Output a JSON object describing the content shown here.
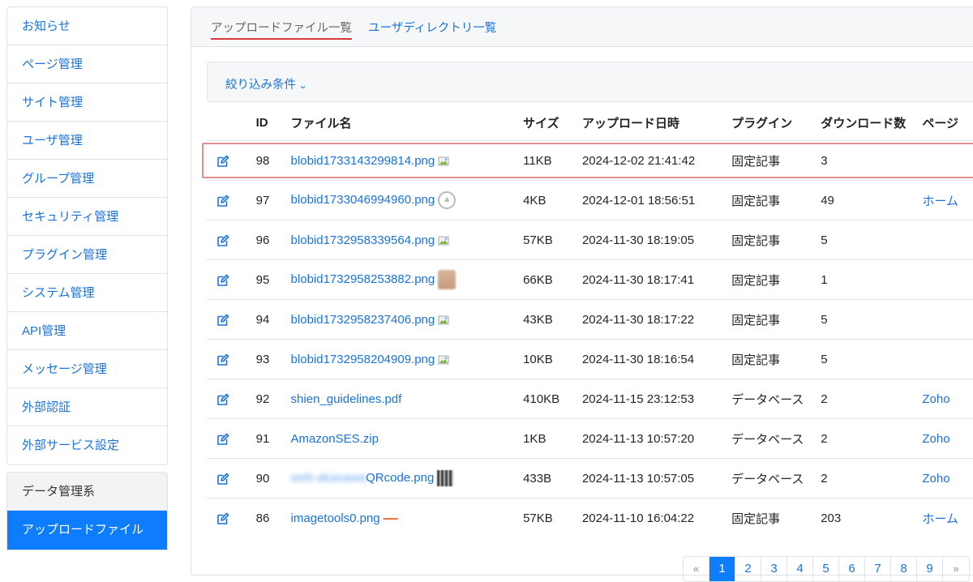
{
  "sidebar": {
    "items": [
      {
        "label": "お知らせ"
      },
      {
        "label": "ページ管理"
      },
      {
        "label": "サイト管理"
      },
      {
        "label": "ユーザ管理"
      },
      {
        "label": "グループ管理"
      },
      {
        "label": "セキュリティ管理"
      },
      {
        "label": "プラグイン管理"
      },
      {
        "label": "システム管理"
      },
      {
        "label": "API管理"
      },
      {
        "label": "メッセージ管理"
      },
      {
        "label": "外部認証"
      },
      {
        "label": "外部サービス設定"
      }
    ],
    "data_group_header": "データ管理系",
    "active_item": "アップロードファイル"
  },
  "tabs": {
    "uploaded_files": "アップロードファイル一覧",
    "user_directories": "ユーザディレクトリ一覧"
  },
  "filter": {
    "label": "絞り込み条件"
  },
  "table": {
    "headers": {
      "id": "ID",
      "name": "ファイル名",
      "size": "サイズ",
      "date": "アップロード日時",
      "plugin": "プラグイン",
      "downloads": "ダウンロード数",
      "page": "ページ"
    },
    "rows": [
      {
        "id": "98",
        "name": "blobid1733143299814.png",
        "thumb": "broken-image-icon",
        "size": "11KB",
        "date": "2024-12-02 21:41:42",
        "plugin": "固定記事",
        "downloads": "3",
        "page": ""
      },
      {
        "id": "97",
        "name": "blobid1733046994960.png",
        "thumb": "up-arrow-circle-thumbnail",
        "size": "4KB",
        "date": "2024-12-01 18:56:51",
        "plugin": "固定記事",
        "downloads": "49",
        "page": "ホーム"
      },
      {
        "id": "96",
        "name": "blobid1732958339564.png",
        "thumb": "broken-image-icon",
        "size": "57KB",
        "date": "2024-11-30 18:19:05",
        "plugin": "固定記事",
        "downloads": "5",
        "page": ""
      },
      {
        "id": "95",
        "name": "blobid1732958253882.png",
        "thumb": "portrait-thumbnail",
        "size": "66KB",
        "date": "2024-11-30 18:17:41",
        "plugin": "固定記事",
        "downloads": "1",
        "page": ""
      },
      {
        "id": "94",
        "name": "blobid1732958237406.png",
        "thumb": "broken-image-icon",
        "size": "43KB",
        "date": "2024-11-30 18:17:22",
        "plugin": "固定記事",
        "downloads": "5",
        "page": ""
      },
      {
        "id": "93",
        "name": "blobid1732958204909.png",
        "thumb": "broken-image-icon",
        "size": "10KB",
        "date": "2024-11-30 18:16:54",
        "plugin": "固定記事",
        "downloads": "5",
        "page": ""
      },
      {
        "id": "92",
        "name": "shien_guidelines.pdf",
        "thumb": "",
        "size": "410KB",
        "date": "2024-11-15 23:12:53",
        "plugin": "データベース",
        "downloads": "2",
        "page": "Zoho"
      },
      {
        "id": "91",
        "name": "AmazonSES.zip",
        "thumb": "",
        "size": "1KB",
        "date": "2024-11-13 10:57:20",
        "plugin": "データベース",
        "downloads": "2",
        "page": "Zoho"
      },
      {
        "id": "90",
        "name": "QRcode.png",
        "name_prefix": "web-akaoawa",
        "thumb": "qr-code-thumbnail",
        "size": "433B",
        "date": "2024-11-13 10:57:05",
        "plugin": "データベース",
        "downloads": "2",
        "page": "Zoho"
      },
      {
        "id": "86",
        "name": "imagetools0.png",
        "thumb": "tiny-text-thumbnail",
        "size": "57KB",
        "date": "2024-11-10 16:04:22",
        "plugin": "固定記事",
        "downloads": "203",
        "page": "ホーム"
      }
    ]
  },
  "pagination": {
    "prev": "«",
    "pages": [
      "1",
      "2",
      "3",
      "4",
      "5",
      "6",
      "7",
      "8",
      "9"
    ],
    "current": "1",
    "next": "»"
  },
  "colors": {
    "link": "#1a73d9",
    "active": "#0d7dfd",
    "highlight": "#e48e8e"
  }
}
